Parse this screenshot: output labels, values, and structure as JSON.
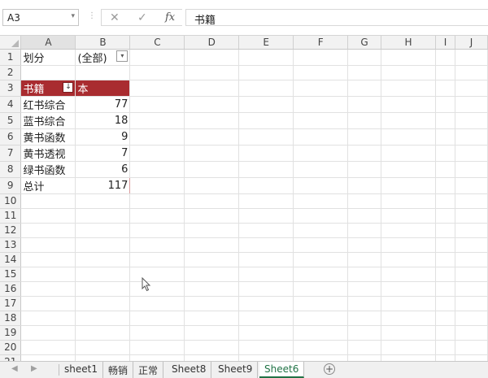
{
  "formula_bar": {
    "name_box": "A3",
    "formula": "书籍",
    "cancel_icon": "✕",
    "enter_icon": "✓",
    "fx_label": "fx"
  },
  "columns": [
    "A",
    "B",
    "C",
    "D",
    "E",
    "F",
    "G",
    "H",
    "I",
    "J"
  ],
  "rows": [
    "1",
    "2",
    "3",
    "4",
    "5",
    "6",
    "7",
    "8",
    "9",
    "10",
    "11",
    "12",
    "13",
    "14",
    "15",
    "16",
    "17",
    "18",
    "19",
    "20",
    "21"
  ],
  "pivot": {
    "filter_label": "划分",
    "filter_value": "(全部)",
    "header_row": "书籍",
    "header_value": "本",
    "items": [
      {
        "name": "红书综合",
        "value": "77"
      },
      {
        "name": "蓝书综合",
        "value": "18"
      },
      {
        "name": "黄书函数",
        "value": "9"
      },
      {
        "name": "黄书透视",
        "value": "7"
      },
      {
        "name": "绿书函数",
        "value": "6"
      }
    ],
    "total_label": "总计",
    "total_value": "117"
  },
  "sheet_tabs": [
    "sheet1",
    "畅销",
    "正常",
    "Sheet8",
    "Sheet9",
    "Sheet6"
  ],
  "active_tab": "Sheet6",
  "colors": {
    "pivot_header": "#a92c30",
    "active_tab": "#217346"
  }
}
